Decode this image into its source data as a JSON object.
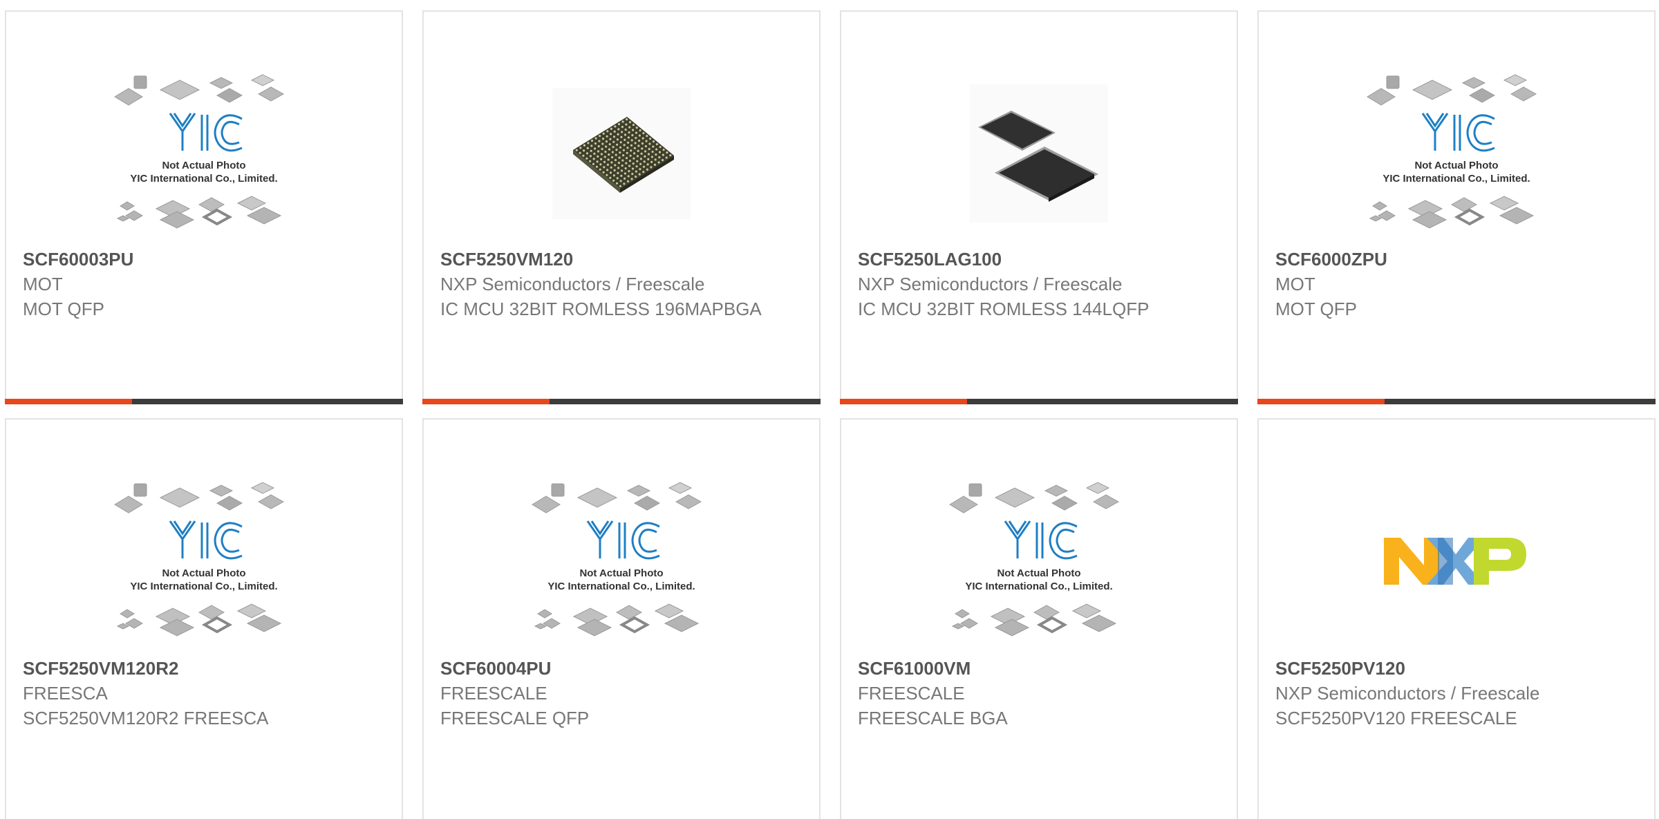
{
  "placeholder_image": {
    "brand_text": "YIC",
    "line1": "Not Actual Photo",
    "line2": "YIC International Co., Limited."
  },
  "colors": {
    "accent_orange": "#e8461b",
    "accent_dark": "#3c3c3c",
    "card_border": "#e3e3e3",
    "yic_blue": "#1f7fc4"
  },
  "products": [
    {
      "part_number": "SCF60003PU",
      "manufacturer": "MOT",
      "description": "MOT QFP",
      "image": "yic-placeholder"
    },
    {
      "part_number": "SCF5250VM120",
      "manufacturer": "NXP Semiconductors / Freescale",
      "description": "IC MCU 32BIT ROMLESS 196MAPBGA",
      "image": "bga-chip-photo"
    },
    {
      "part_number": "SCF5250LAG100",
      "manufacturer": "NXP Semiconductors / Freescale",
      "description": "IC MCU 32BIT ROMLESS 144LQFP",
      "image": "lqfp-chip-photo"
    },
    {
      "part_number": "SCF6000ZPU",
      "manufacturer": "MOT",
      "description": "MOT QFP",
      "image": "yic-placeholder"
    },
    {
      "part_number": "SCF5250VM120R2",
      "manufacturer": "FREESCA",
      "description": "SCF5250VM120R2 FREESCA",
      "image": "yic-placeholder"
    },
    {
      "part_number": "SCF60004PU",
      "manufacturer": "FREESCALE",
      "description": "FREESCALE QFP",
      "image": "yic-placeholder"
    },
    {
      "part_number": "SCF61000VM",
      "manufacturer": "FREESCALE",
      "description": "FREESCALE BGA",
      "image": "yic-placeholder"
    },
    {
      "part_number": "SCF5250PV120",
      "manufacturer": "NXP Semiconductors / Freescale",
      "description": "SCF5250PV120 FREESCALE",
      "image": "nxp-logo"
    }
  ]
}
